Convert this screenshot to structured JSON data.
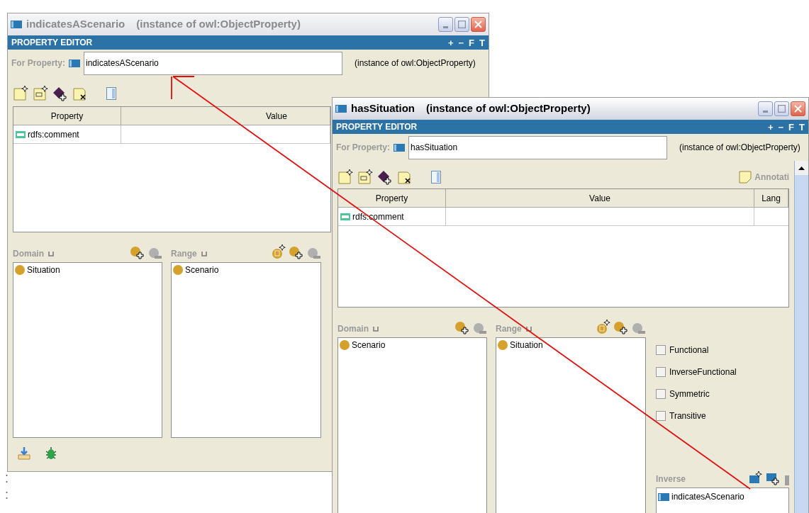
{
  "windows": [
    {
      "title": "indicatesAScenario",
      "subtitle": "(instance of owl:ObjectProperty)",
      "active": false,
      "header": "PROPERTY EDITOR",
      "header_buttons": [
        "+",
        "−",
        "F",
        "T"
      ],
      "for_property_label": "For Property:",
      "property_name": "indicatesAScenario",
      "property_type": "(instance of owl:ObjectProperty)",
      "table": {
        "columns": [
          "Property",
          "Value"
        ],
        "rows": [
          {
            "property": "rdfs:comment"
          }
        ]
      },
      "domain": {
        "label": "Domain",
        "items": [
          "Situation"
        ]
      },
      "range": {
        "label": "Range",
        "items": [
          "Scenario"
        ]
      }
    },
    {
      "title": "hasSituation",
      "subtitle": "(instance of owl:ObjectProperty)",
      "active": true,
      "header": "PROPERTY EDITOR",
      "header_buttons": [
        "+",
        "−",
        "F",
        "T"
      ],
      "for_property_label": "For Property:",
      "property_name": "hasSituation",
      "property_type": "(instance of owl:ObjectProperty)",
      "annotation_label": "Annotati",
      "table": {
        "columns": [
          "Property",
          "Value",
          "Lang"
        ],
        "rows": [
          {
            "property": "rdfs:comment"
          }
        ]
      },
      "domain": {
        "label": "Domain",
        "items": [
          "Scenario"
        ]
      },
      "range": {
        "label": "Range",
        "items": [
          "Situation"
        ]
      },
      "characteristics": [
        {
          "label": "Functional",
          "checked": false
        },
        {
          "label": "InverseFunctional",
          "checked": false
        },
        {
          "label": "Symmetric",
          "checked": false
        },
        {
          "label": "Transitive",
          "checked": false
        }
      ],
      "inverse": {
        "label": "Inverse",
        "items": [
          "indicatesAScenario"
        ]
      }
    }
  ]
}
